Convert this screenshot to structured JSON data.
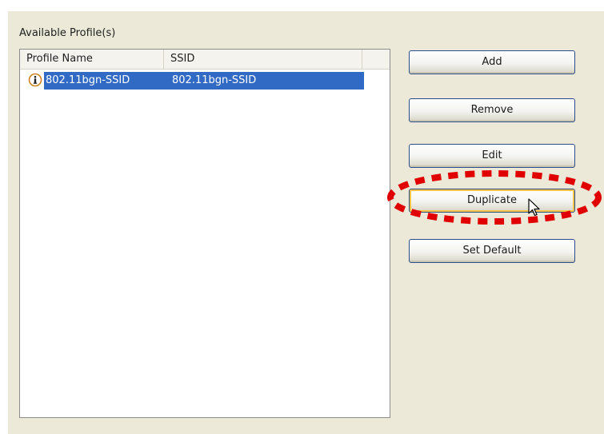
{
  "profiles_group": {
    "title": "Available Profile(s)",
    "columns": [
      "Profile Name",
      "SSID",
      ""
    ],
    "rows": [
      {
        "profile_name": "802.11bgn-SSID",
        "ssid": "802.11bgn-SSID",
        "selected": true,
        "icon": "info-icon"
      }
    ]
  },
  "buttons": {
    "add": "Add",
    "remove": "Remove",
    "edit": "Edit",
    "duplicate": "Duplicate",
    "set_default": "Set Default"
  },
  "annotation": {
    "highlight": "duplicate",
    "color": "#e00000"
  },
  "colors": {
    "selection": "#316ac5",
    "panel": "#ece9d8",
    "button_border": "#2d4d8a",
    "hot_border": "#f7c548"
  }
}
